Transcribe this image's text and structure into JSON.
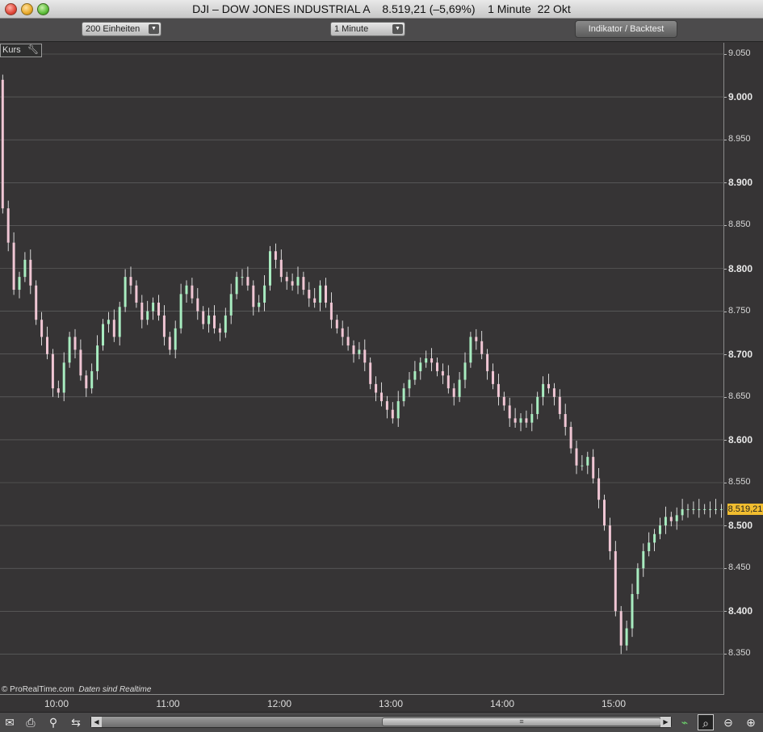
{
  "window": {
    "title": "DJI – DOW JONES INDUSTRIAL A    8.519,21 (–5,69%)    1 Minute  22 Okt"
  },
  "toolbar": {
    "units_select": "200 Einheiten",
    "interval_select": "1 Minute",
    "indicator_button": "Indikator / Backtest"
  },
  "panel": {
    "label": "Kurs"
  },
  "price_axis": {
    "ticks": [
      "9.050",
      "9.000",
      "8.950",
      "8.900",
      "8.850",
      "8.800",
      "8.750",
      "8.700",
      "8.650",
      "8.600",
      "8.550",
      "8.500",
      "8.450",
      "8.400",
      "8.350"
    ],
    "current_price": "8.519,21"
  },
  "time_axis": {
    "ticks": [
      "10:00",
      "11:00",
      "12:00",
      "13:00",
      "14:00",
      "15:00"
    ]
  },
  "credit": {
    "site": "© ProRealTime.com",
    "note": "Daten sind Realtime"
  },
  "colors": {
    "up_candle": "#a8ecc0",
    "down_candle": "#f0c6d4",
    "wick": "#ffffff",
    "price_tag": "#f1bd2f",
    "background": "#363435",
    "grid": "#6a6a6a"
  },
  "chart_data": {
    "type": "candlestick",
    "title": "DJI – DOW JONES INDUSTRIAL A",
    "interval": "1 Minute",
    "ylim": [
      8325,
      9065
    ],
    "grid": true,
    "x": [
      "09:31",
      "09:34",
      "09:37",
      "09:40",
      "09:43",
      "09:46",
      "09:49",
      "09:52",
      "09:55",
      "09:58",
      "10:01",
      "10:04",
      "10:07",
      "10:10",
      "10:13",
      "10:16",
      "10:19",
      "10:22",
      "10:25",
      "10:28",
      "10:31",
      "10:34",
      "10:37",
      "10:40",
      "10:43",
      "10:46",
      "10:49",
      "10:52",
      "10:55",
      "10:58",
      "11:01",
      "11:04",
      "11:07",
      "11:10",
      "11:13",
      "11:16",
      "11:19",
      "11:22",
      "11:25",
      "11:28",
      "11:31",
      "11:34",
      "11:37",
      "11:40",
      "11:43",
      "11:46",
      "11:49",
      "11:52",
      "11:55",
      "11:58",
      "12:01",
      "12:04",
      "12:07",
      "12:10",
      "12:13",
      "12:16",
      "12:19",
      "12:22",
      "12:25",
      "12:28",
      "12:31",
      "12:34",
      "12:37",
      "12:40",
      "12:43",
      "12:46",
      "12:49",
      "12:52",
      "12:55",
      "12:58",
      "13:01",
      "13:04",
      "13:07",
      "13:10",
      "13:13",
      "13:16",
      "13:19",
      "13:22",
      "13:25",
      "13:28",
      "13:31",
      "13:34",
      "13:37",
      "13:40",
      "13:43",
      "13:46",
      "13:49",
      "13:52",
      "13:55",
      "13:58",
      "14:01",
      "14:04",
      "14:07",
      "14:10",
      "14:13",
      "14:16",
      "14:19",
      "14:22",
      "14:25",
      "14:28",
      "14:31",
      "14:34",
      "14:37",
      "14:40",
      "14:43",
      "14:46",
      "14:49",
      "14:52",
      "14:55",
      "14:58",
      "15:01",
      "15:04",
      "15:07",
      "15:10",
      "15:13",
      "15:16",
      "15:19",
      "15:22",
      "15:25",
      "15:28",
      "15:31",
      "15:34",
      "15:37",
      "15:40",
      "15:43",
      "15:46",
      "15:49",
      "15:52",
      "15:55",
      "15:58"
    ],
    "close": [
      8870,
      8830,
      8775,
      8790,
      8810,
      8780,
      8740,
      8720,
      8700,
      8660,
      8655,
      8690,
      8720,
      8705,
      8675,
      8660,
      8680,
      8710,
      8735,
      8740,
      8720,
      8755,
      8790,
      8780,
      8760,
      8740,
      8750,
      8760,
      8745,
      8720,
      8705,
      8730,
      8770,
      8780,
      8765,
      8750,
      8735,
      8745,
      8730,
      8725,
      8745,
      8770,
      8790,
      8790,
      8780,
      8755,
      8760,
      8780,
      8820,
      8810,
      8790,
      8785,
      8780,
      8790,
      8775,
      8765,
      8760,
      8780,
      8760,
      8740,
      8730,
      8720,
      8710,
      8700,
      8705,
      8690,
      8665,
      8655,
      8645,
      8635,
      8625,
      8645,
      8660,
      8670,
      8680,
      8690,
      8695,
      8690,
      8680,
      8675,
      8660,
      8650,
      8670,
      8690,
      8720,
      8715,
      8700,
      8680,
      8665,
      8650,
      8640,
      8625,
      8620,
      8625,
      8620,
      8630,
      8650,
      8665,
      8660,
      8650,
      8630,
      8615,
      8590,
      8570,
      8570,
      8580,
      8555,
      8530,
      8500,
      8470,
      8400,
      8360,
      8380,
      8420,
      8450,
      8470,
      8480,
      8490,
      8500,
      8510,
      8505,
      8512,
      8519,
      8519,
      8519,
      8519,
      8519,
      8519,
      8519,
      8519
    ],
    "price_axis_label": "8.519,21"
  }
}
